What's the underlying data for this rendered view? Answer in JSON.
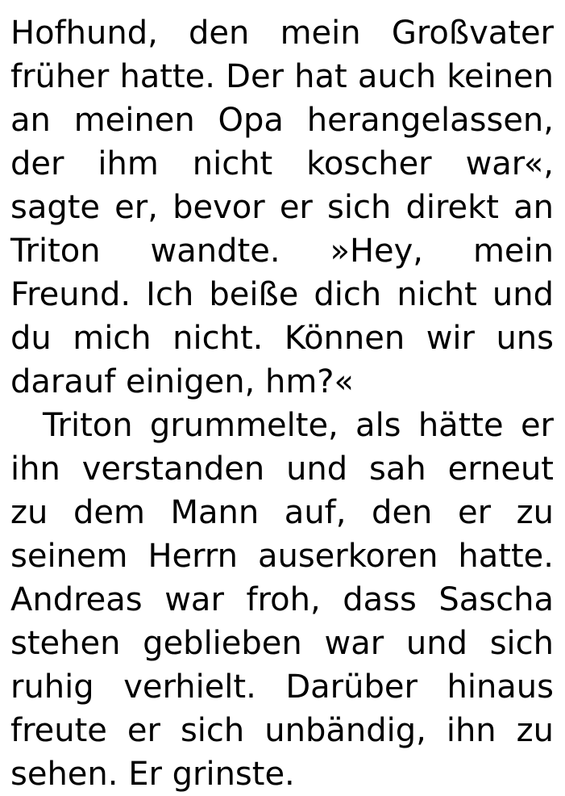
{
  "document": {
    "paragraphs": [
      "Hofhund, den mein Großvater früher hatte. Der hat auch keinen an meinen Opa herangelassen, der ihm nicht koscher war«, sagte er, bevor er sich direkt an Triton wandte. »Hey, mein Freund. Ich beiße dich nicht und du mich nicht. Können wir uns darauf einigen, hm?«",
      "Triton grummelte, als hätte er ihn verstanden und sah erneut zu dem Mann auf, den er zu seinem Herrn auserkoren hatte. Andreas war froh, dass Sascha stehen geblieben war und sich ruhig verhielt. Darüber hinaus freute er sich unbändig, ihn zu sehen. Er grinste."
    ]
  }
}
